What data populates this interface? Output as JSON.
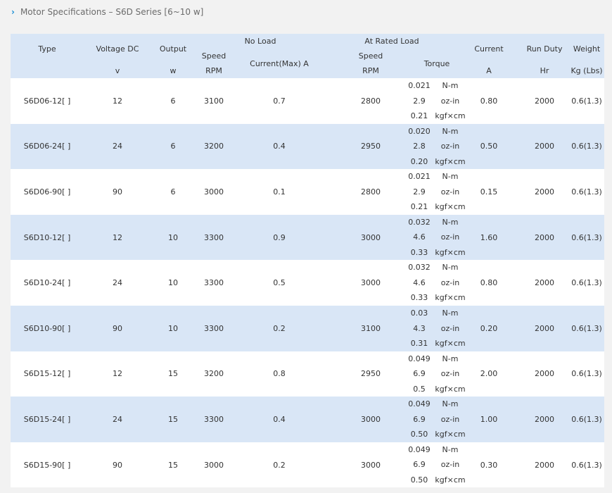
{
  "title": {
    "icon": "chevron-right-icon",
    "text": "Motor Specifications – S6D Series [6~10 w]"
  },
  "headers": {
    "type": "Type",
    "voltage": "Voltage DC",
    "voltage_unit": "v",
    "output": "Output",
    "output_unit": "w",
    "no_load": "No Load",
    "nl_speed": "Speed",
    "nl_speed_unit": "RPM",
    "nl_current": "Current(Max) A",
    "rated_load": "At Rated Load",
    "rl_speed": "Speed",
    "rl_speed_unit": "RPM",
    "torque": "Torque",
    "current": "Current",
    "current_unit": "A",
    "run_duty": "Run Duty",
    "run_duty_unit": "Hr",
    "weight": "Weight",
    "weight_unit": "Kg (Lbs)"
  },
  "torque_units": [
    "N-m",
    "oz-in",
    "kgf×cm"
  ],
  "rows": [
    {
      "type": "S6D06-12[ ]",
      "voltage": "12",
      "output": "6",
      "nl_speed": "3100",
      "nl_current": "0.7",
      "rl_speed": "2800",
      "torque": [
        "0.021",
        "2.9",
        "0.21"
      ],
      "current": "0.80",
      "run_duty": "2000",
      "weight": "0.6(1.3)"
    },
    {
      "type": "S6D06-24[ ]",
      "voltage": "24",
      "output": "6",
      "nl_speed": "3200",
      "nl_current": "0.4",
      "rl_speed": "2950",
      "torque": [
        "0.020",
        "2.8",
        "0.20"
      ],
      "current": "0.50",
      "run_duty": "2000",
      "weight": "0.6(1.3)"
    },
    {
      "type": "S6D06-90[ ]",
      "voltage": "90",
      "output": "6",
      "nl_speed": "3000",
      "nl_current": "0.1",
      "rl_speed": "2800",
      "torque": [
        "0.021",
        "2.9",
        "0.21"
      ],
      "current": "0.15",
      "run_duty": "2000",
      "weight": "0.6(1.3)"
    },
    {
      "type": "S6D10-12[ ]",
      "voltage": "12",
      "output": "10",
      "nl_speed": "3300",
      "nl_current": "0.9",
      "rl_speed": "3000",
      "torque": [
        "0.032",
        "4.6",
        "0.33"
      ],
      "current": "1.60",
      "run_duty": "2000",
      "weight": "0.6(1.3)"
    },
    {
      "type": "S6D10-24[ ]",
      "voltage": "24",
      "output": "10",
      "nl_speed": "3300",
      "nl_current": "0.5",
      "rl_speed": "3000",
      "torque": [
        "0.032",
        "4.6",
        "0.33"
      ],
      "current": "0.80",
      "run_duty": "2000",
      "weight": "0.6(1.3)"
    },
    {
      "type": "S6D10-90[ ]",
      "voltage": "90",
      "output": "10",
      "nl_speed": "3300",
      "nl_current": "0.2",
      "rl_speed": "3100",
      "torque": [
        "0.03",
        "4.3",
        "0.31"
      ],
      "current": "0.20",
      "run_duty": "2000",
      "weight": "0.6(1.3)"
    },
    {
      "type": "S6D15-12[ ]",
      "voltage": "12",
      "output": "15",
      "nl_speed": "3200",
      "nl_current": "0.8",
      "rl_speed": "2950",
      "torque": [
        "0.049",
        "6.9",
        "0.5"
      ],
      "current": "2.00",
      "run_duty": "2000",
      "weight": "0.6(1.3)"
    },
    {
      "type": "S6D15-24[ ]",
      "voltage": "24",
      "output": "15",
      "nl_speed": "3300",
      "nl_current": "0.4",
      "rl_speed": "3000",
      "torque": [
        "0.049",
        "6.9",
        "0.50"
      ],
      "current": "1.00",
      "run_duty": "2000",
      "weight": "0.6(1.3)"
    },
    {
      "type": "S6D15-90[ ]",
      "voltage": "90",
      "output": "15",
      "nl_speed": "3000",
      "nl_current": "0.2",
      "rl_speed": "3000",
      "torque": [
        "0.049",
        "6.9",
        "0.50"
      ],
      "current": "0.30",
      "run_duty": "2000",
      "weight": "0.6(1.3)"
    }
  ]
}
